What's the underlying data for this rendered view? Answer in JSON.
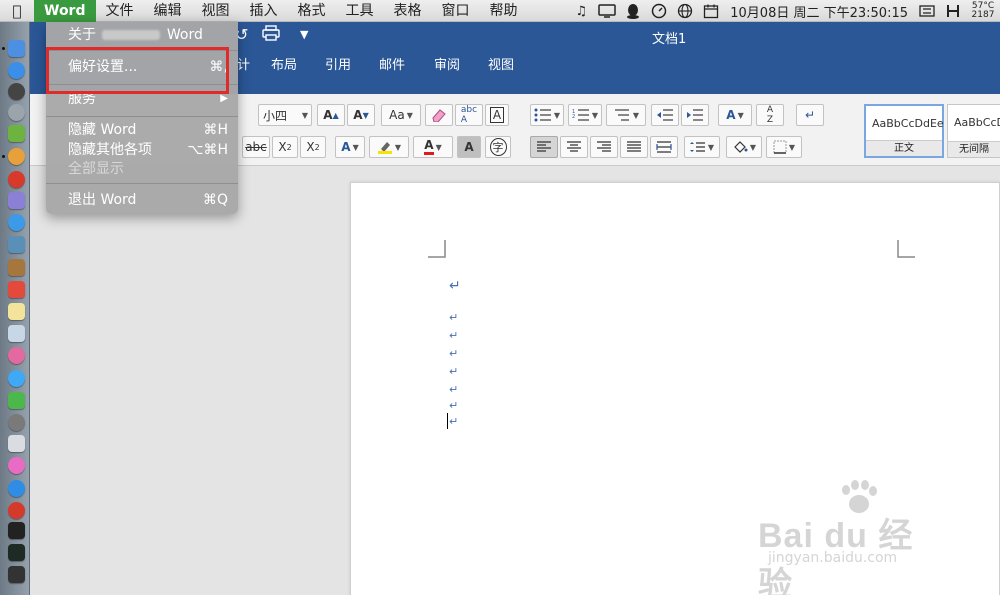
{
  "menubar": {
    "apple": "",
    "items": [
      "Word",
      "文件",
      "编辑",
      "视图",
      "插入",
      "格式",
      "工具",
      "表格",
      "窗口",
      "帮助"
    ],
    "active_item": "Word",
    "clock": "10月08日 周二 下午23:50:15",
    "temp_top": "57°C",
    "temp_bottom": "2187"
  },
  "window": {
    "title": "文档1",
    "tabs": [
      "布局",
      "引用",
      "邮件",
      "审阅",
      "视图"
    ],
    "partial_tab": "计"
  },
  "ribbon": {
    "font_size": "小四",
    "strikethrough_label": "abc",
    "char_border_label": "A",
    "enclose_char_label": "字",
    "styles": [
      {
        "sample": "AaBbCcDdEe",
        "name": "正文"
      },
      {
        "sample": "AaBbCcD",
        "name": "无间隔"
      }
    ]
  },
  "word_menu": {
    "items": [
      {
        "label": "关于",
        "label_suffix": "Word",
        "shortcut": ""
      },
      {
        "label": "偏好设置...",
        "shortcut": "⌘,"
      },
      {
        "label": "服务",
        "shortcut": "▶"
      },
      {
        "label": "隐藏 Word",
        "shortcut": "⌘H"
      },
      {
        "label": "隐藏其他各项",
        "shortcut": "⌥⌘H"
      },
      {
        "label": "全部显示",
        "shortcut": ""
      },
      {
        "label": "退出 Word",
        "shortcut": "⌘Q"
      }
    ]
  },
  "document": {
    "paragraph_marks": [
      "↵",
      "↵",
      "↵",
      "↵",
      "↵",
      "↵",
      "↵",
      "↵"
    ]
  },
  "watermark": {
    "brand": "Bai du 经验",
    "url": "jingyan.baidu.com"
  },
  "colors": {
    "menu_active": "#3a9a3f",
    "title_bar": "#2b5797",
    "highlight_box": "#e02b2b",
    "paragraph_mark": "#4a6fb5"
  }
}
